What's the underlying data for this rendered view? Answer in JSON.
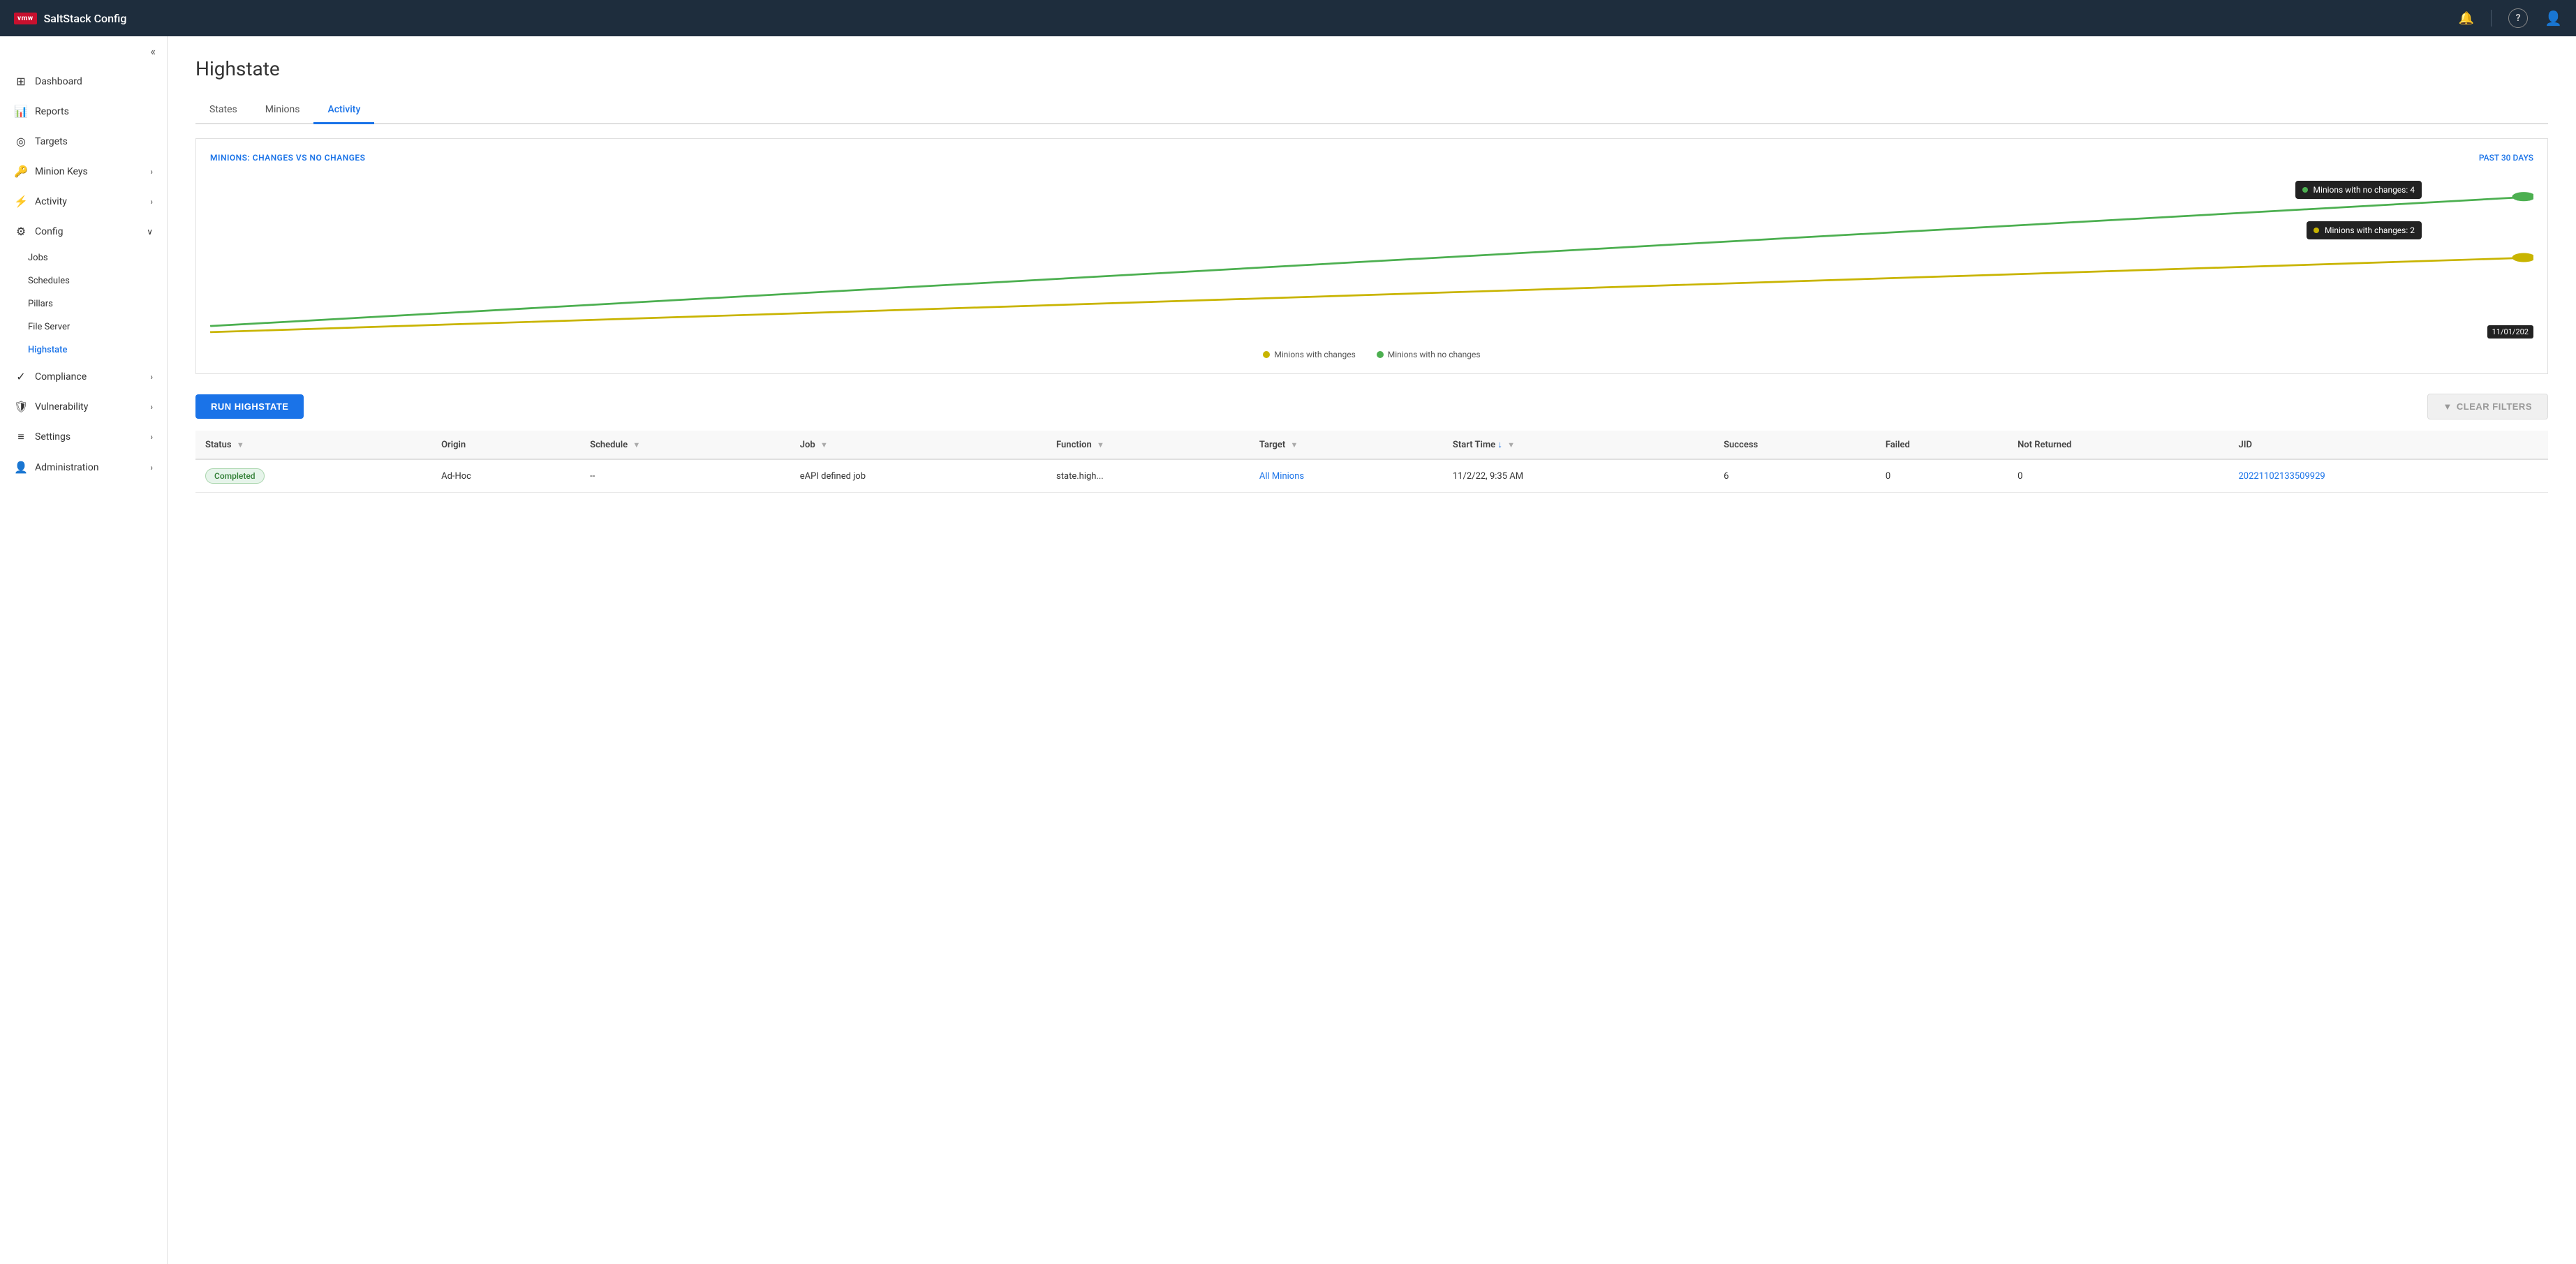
{
  "app": {
    "brand": "SaltStack Config",
    "vmw_label": "vmw"
  },
  "topnav": {
    "bell_icon": "🔔",
    "help_icon": "?",
    "user_icon": "👤"
  },
  "sidebar": {
    "collapse_icon": "«",
    "items": [
      {
        "id": "dashboard",
        "label": "Dashboard",
        "icon": "⊞",
        "has_chevron": false
      },
      {
        "id": "reports",
        "label": "Reports",
        "icon": "📊",
        "has_chevron": false
      },
      {
        "id": "targets",
        "label": "Targets",
        "icon": "◎",
        "has_chevron": false
      },
      {
        "id": "minion-keys",
        "label": "Minion Keys",
        "icon": "🔑",
        "has_chevron": true
      },
      {
        "id": "activity",
        "label": "Activity",
        "icon": "⚡",
        "has_chevron": true
      },
      {
        "id": "config",
        "label": "Config",
        "icon": "⚙",
        "has_chevron": true,
        "expanded": true
      },
      {
        "id": "compliance",
        "label": "Compliance",
        "icon": "✓",
        "has_chevron": true
      },
      {
        "id": "vulnerability",
        "label": "Vulnerability",
        "icon": "🛡",
        "has_chevron": true
      },
      {
        "id": "settings",
        "label": "Settings",
        "icon": "≡",
        "has_chevron": true
      },
      {
        "id": "administration",
        "label": "Administration",
        "icon": "👤",
        "has_chevron": true
      }
    ],
    "config_submenu": [
      {
        "id": "jobs",
        "label": "Jobs",
        "active": false
      },
      {
        "id": "schedules",
        "label": "Schedules",
        "active": false
      },
      {
        "id": "pillars",
        "label": "Pillars",
        "active": false
      },
      {
        "id": "file-server",
        "label": "File Server",
        "active": false
      },
      {
        "id": "highstate",
        "label": "Highstate",
        "active": true
      }
    ]
  },
  "page": {
    "title": "Highstate",
    "tabs": [
      {
        "id": "states",
        "label": "States",
        "active": false
      },
      {
        "id": "minions",
        "label": "Minions",
        "active": false
      },
      {
        "id": "activity",
        "label": "Activity",
        "active": true
      }
    ]
  },
  "chart": {
    "title": "MINIONS: CHANGES VS NO CHANGES",
    "period": "PAST 30 DAYS",
    "legend": [
      {
        "id": "changes",
        "label": "Minions with changes",
        "color": "#c8b400"
      },
      {
        "id": "no-changes",
        "label": "Minions with no changes",
        "color": "#4caf50"
      }
    ],
    "tooltip_no_changes": "Minions with no changes: 4",
    "tooltip_changes": "Minions with changes: 2",
    "tooltip_date": "11/01/202",
    "dot_no_changes_color": "#4caf50",
    "dot_changes_color": "#c8b400"
  },
  "actions": {
    "run_highstate_label": "RUN HIGHSTATE",
    "clear_filters_label": "CLEAR FILTERS",
    "filter_icon": "▼"
  },
  "table": {
    "columns": [
      {
        "id": "status",
        "label": "Status",
        "has_filter": true
      },
      {
        "id": "origin",
        "label": "Origin",
        "has_filter": false
      },
      {
        "id": "schedule",
        "label": "Schedule",
        "has_filter": true
      },
      {
        "id": "job",
        "label": "Job",
        "has_filter": true
      },
      {
        "id": "function",
        "label": "Function",
        "has_filter": true
      },
      {
        "id": "target",
        "label": "Target",
        "has_filter": true
      },
      {
        "id": "start-time",
        "label": "Start Time",
        "has_filter": true,
        "sorted": true
      },
      {
        "id": "success",
        "label": "Success",
        "has_filter": false
      },
      {
        "id": "failed",
        "label": "Failed",
        "has_filter": false
      },
      {
        "id": "not-returned",
        "label": "Not Returned",
        "has_filter": false
      },
      {
        "id": "jid",
        "label": "JID",
        "has_filter": false
      }
    ],
    "rows": [
      {
        "status": "Completed",
        "status_type": "completed",
        "origin": "Ad-Hoc",
        "schedule": "--",
        "job": "eAPI defined job",
        "function": "state.high...",
        "target": "All Minions",
        "start_time": "11/2/22, 9:35 AM",
        "success": "6",
        "failed": "0",
        "not_returned": "0",
        "jid": "20221102133509929",
        "target_link": true,
        "jid_link": true
      }
    ]
  }
}
